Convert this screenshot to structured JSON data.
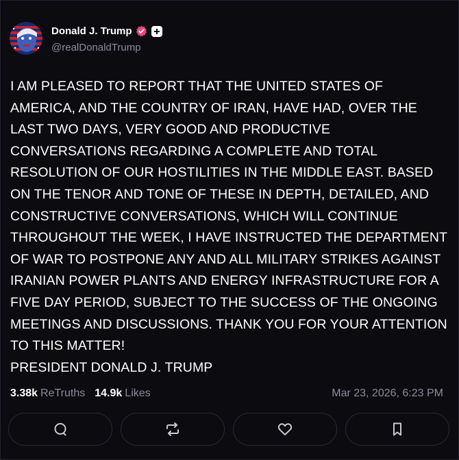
{
  "author": {
    "display_name": "Donald J. Trump",
    "handle": "@realDonaldTrump",
    "verified_color": "#e8457a"
  },
  "post": {
    "text": "I AM PLEASED TO REPORT THAT THE UNITED STATES OF AMERICA, AND THE COUNTRY OF IRAN, HAVE HAD, OVER THE LAST TWO DAYS, VERY GOOD AND PRODUCTIVE CONVERSATIONS REGARDING A COMPLETE AND TOTAL RESOLUTION OF OUR HOSTILITIES IN THE MIDDLE EAST. BASED ON THE TENOR AND TONE OF THESE IN DEPTH, DETAILED, AND CONSTRUCTIVE CONVERSATIONS, WHICH WILL CONTINUE THROUGHOUT THE WEEK, I HAVE INSTRUCTED THE DEPARTMENT OF WAR TO POSTPONE ANY AND ALL MILITARY STRIKES AGAINST IRANIAN POWER PLANTS AND ENERGY INFRASTRUCTURE FOR A FIVE DAY PERIOD, SUBJECT TO THE SUCCESS OF THE ONGOING MEETINGS AND DISCUSSIONS. THANK YOU FOR YOUR ATTENTION TO THIS MATTER!\nPRESIDENT DONALD J. TRUMP"
  },
  "stats": {
    "retruths_count": "3.38k",
    "retruths_label": "ReTruths",
    "likes_count": "14.9k",
    "likes_label": "Likes",
    "timestamp": "Mar 23, 2026, 6:23 PM"
  },
  "actions": {
    "reply_icon": "reply-icon",
    "retruth_icon": "retruth-icon",
    "like_icon": "heart-icon",
    "bookmark_icon": "bookmark-icon"
  }
}
